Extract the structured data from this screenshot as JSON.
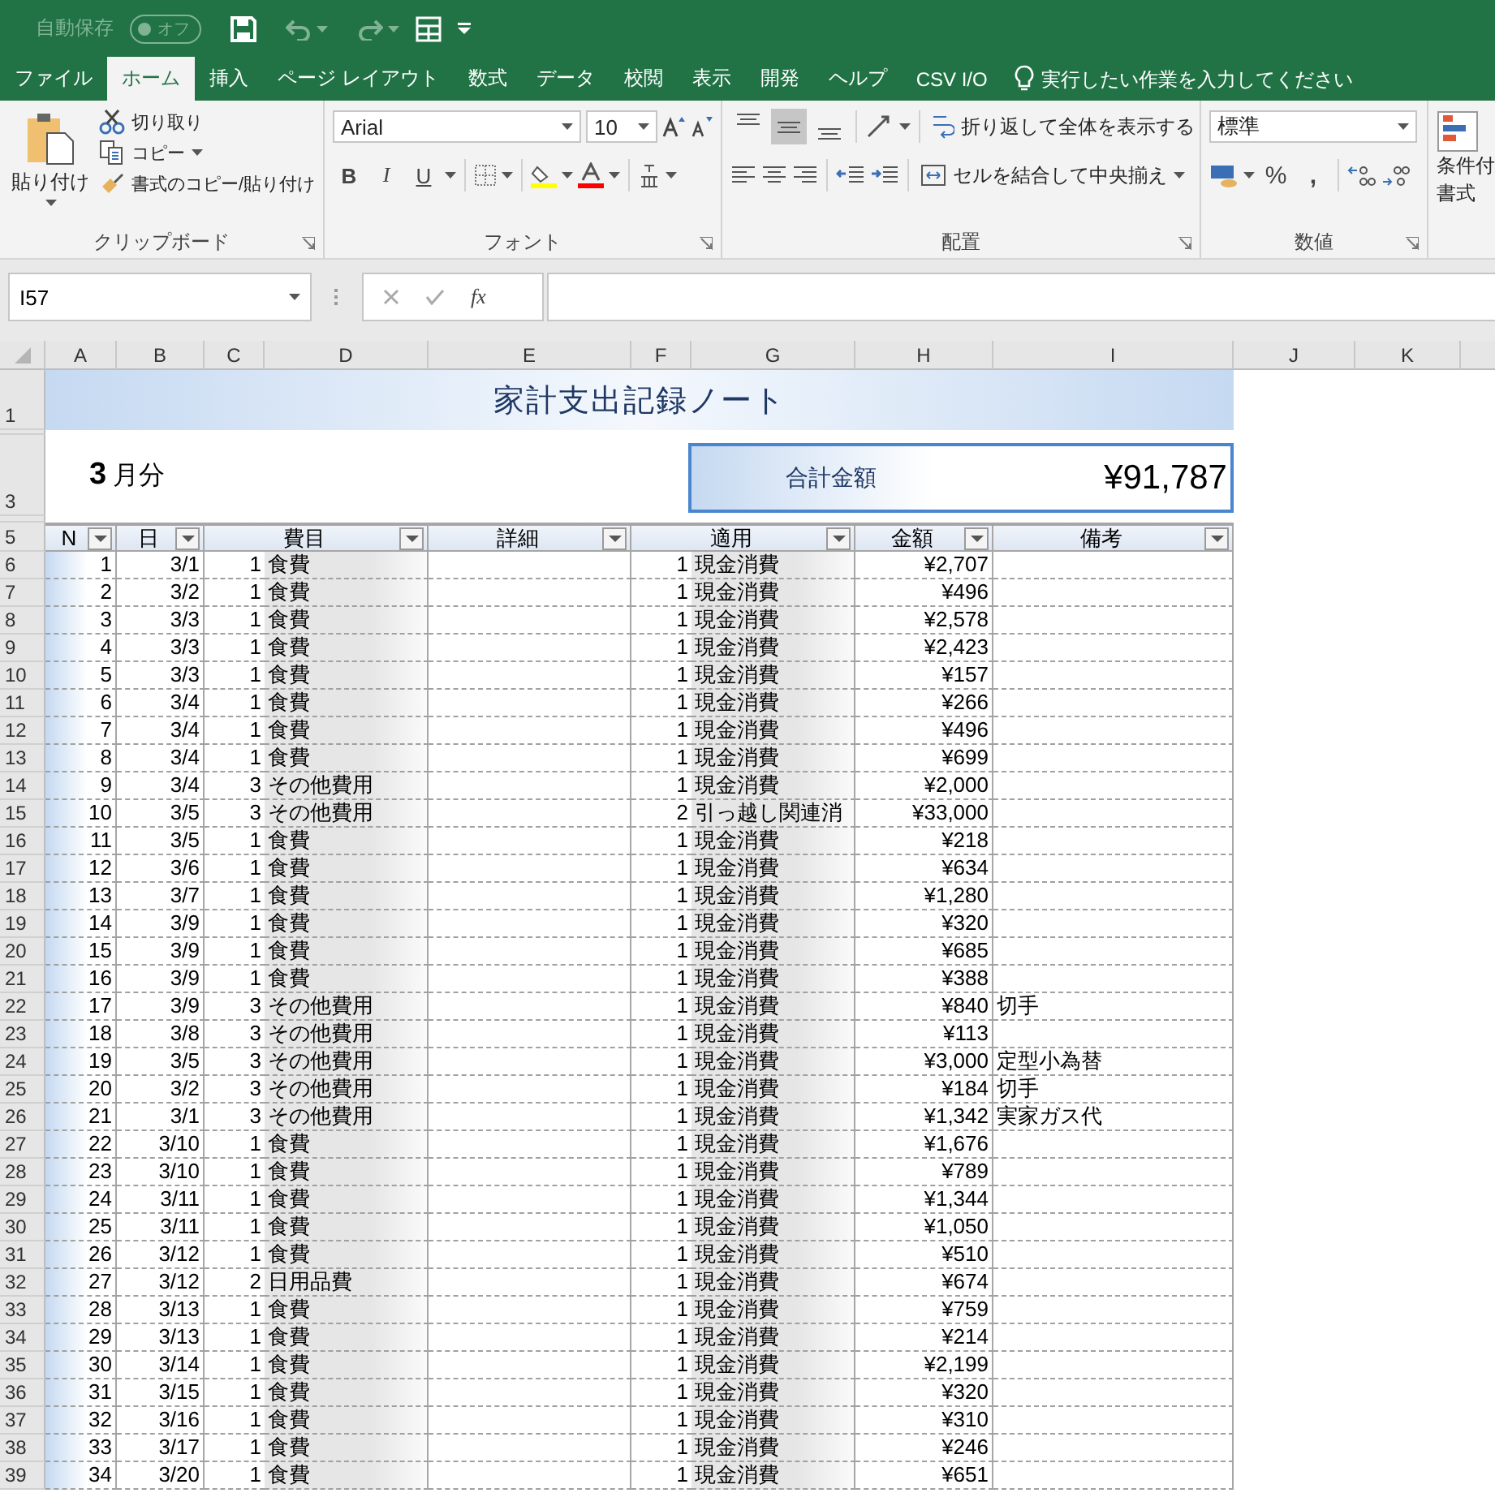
{
  "quick_access": {
    "autosave_label": "自動保存",
    "autosave_on": false,
    "autosave_state": "オフ"
  },
  "tabs": [
    {
      "label": "ファイル",
      "selected": false
    },
    {
      "label": "ホーム",
      "selected": true
    },
    {
      "label": "挿入",
      "selected": false
    },
    {
      "label": "ページ レイアウト",
      "selected": false
    },
    {
      "label": "数式",
      "selected": false
    },
    {
      "label": "データ",
      "selected": false
    },
    {
      "label": "校閲",
      "selected": false
    },
    {
      "label": "表示",
      "selected": false
    },
    {
      "label": "開発",
      "selected": false
    },
    {
      "label": "ヘルプ",
      "selected": false
    },
    {
      "label": "CSV I/O",
      "selected": false
    }
  ],
  "tell_me": {
    "placeholder": "実行したい作業を入力してください"
  },
  "ribbon": {
    "clipboard": {
      "paste": "貼り付け",
      "cut": "切り取り",
      "copy": "コピー",
      "format_painter": "書式のコピー/貼り付け",
      "label": "クリップボード"
    },
    "font": {
      "font_name": "Arial",
      "font_size": "10",
      "styles": [
        {
          "kind": "bold",
          "label": "B"
        },
        {
          "kind": "italic",
          "label": "I"
        },
        {
          "kind": "underline",
          "label": "U"
        }
      ],
      "label": "フォント"
    },
    "alignment": {
      "vertical": [
        {
          "kind": "top",
          "selected": false
        },
        {
          "kind": "middle",
          "selected": true
        },
        {
          "kind": "bottom",
          "selected": false
        }
      ],
      "wrap_text": "折り返して全体を表示する",
      "merge_center": "セルを結合して中央揃え",
      "label": "配置"
    },
    "number": {
      "format": "標準",
      "percent": "%",
      "comma": ",",
      "label": "数値"
    },
    "styles": {
      "conditional_line1": "条件付",
      "conditional_line2": "書式"
    }
  },
  "formula_bar": {
    "name_box": "I57",
    "function_button": "fx"
  },
  "sheet": {
    "columns": [
      "A",
      "B",
      "C",
      "D",
      "E",
      "F",
      "G",
      "H",
      "I",
      "J",
      "K"
    ],
    "title": "家計支出記録ノート",
    "month_number": "3",
    "month_suffix": "月分",
    "total_label": "合計金額",
    "total_value": "¥91,787",
    "header_rows": [
      "1",
      "3",
      "5"
    ],
    "headers": [
      {
        "label": "N"
      },
      {
        "label": "日"
      },
      {
        "label": "費目"
      },
      {
        "label": "詳細"
      },
      {
        "label": "適用"
      },
      {
        "label": "金額"
      },
      {
        "label": "備考"
      }
    ],
    "rows": [
      {
        "row": "6",
        "no": "1",
        "date": "3/1",
        "cat_code": "1",
        "category": "食費",
        "pay_code": "1",
        "payment": "現金消費",
        "amount": "¥2,707"
      },
      {
        "row": "7",
        "no": "2",
        "date": "3/2",
        "cat_code": "1",
        "category": "食費",
        "pay_code": "1",
        "payment": "現金消費",
        "amount": "¥496"
      },
      {
        "row": "8",
        "no": "3",
        "date": "3/3",
        "cat_code": "1",
        "category": "食費",
        "pay_code": "1",
        "payment": "現金消費",
        "amount": "¥2,578"
      },
      {
        "row": "9",
        "no": "4",
        "date": "3/3",
        "cat_code": "1",
        "category": "食費",
        "pay_code": "1",
        "payment": "現金消費",
        "amount": "¥2,423"
      },
      {
        "row": "10",
        "no": "5",
        "date": "3/3",
        "cat_code": "1",
        "category": "食費",
        "pay_code": "1",
        "payment": "現金消費",
        "amount": "¥157"
      },
      {
        "row": "11",
        "no": "6",
        "date": "3/4",
        "cat_code": "1",
        "category": "食費",
        "pay_code": "1",
        "payment": "現金消費",
        "amount": "¥266"
      },
      {
        "row": "12",
        "no": "7",
        "date": "3/4",
        "cat_code": "1",
        "category": "食費",
        "pay_code": "1",
        "payment": "現金消費",
        "amount": "¥496"
      },
      {
        "row": "13",
        "no": "8",
        "date": "3/4",
        "cat_code": "1",
        "category": "食費",
        "pay_code": "1",
        "payment": "現金消費",
        "amount": "¥699"
      },
      {
        "row": "14",
        "no": "9",
        "date": "3/4",
        "cat_code": "3",
        "category": "その他費用",
        "pay_code": "1",
        "payment": "現金消費",
        "amount": "¥2,000"
      },
      {
        "row": "15",
        "no": "10",
        "date": "3/5",
        "cat_code": "3",
        "category": "その他費用",
        "pay_code": "2",
        "payment": "引っ越し関連消",
        "amount": "¥33,000"
      },
      {
        "row": "16",
        "no": "11",
        "date": "3/5",
        "cat_code": "1",
        "category": "食費",
        "pay_code": "1",
        "payment": "現金消費",
        "amount": "¥218"
      },
      {
        "row": "17",
        "no": "12",
        "date": "3/6",
        "cat_code": "1",
        "category": "食費",
        "pay_code": "1",
        "payment": "現金消費",
        "amount": "¥634"
      },
      {
        "row": "18",
        "no": "13",
        "date": "3/7",
        "cat_code": "1",
        "category": "食費",
        "pay_code": "1",
        "payment": "現金消費",
        "amount": "¥1,280"
      },
      {
        "row": "19",
        "no": "14",
        "date": "3/9",
        "cat_code": "1",
        "category": "食費",
        "pay_code": "1",
        "payment": "現金消費",
        "amount": "¥320"
      },
      {
        "row": "20",
        "no": "15",
        "date": "3/9",
        "cat_code": "1",
        "category": "食費",
        "pay_code": "1",
        "payment": "現金消費",
        "amount": "¥685"
      },
      {
        "row": "21",
        "no": "16",
        "date": "3/9",
        "cat_code": "1",
        "category": "食費",
        "pay_code": "1",
        "payment": "現金消費",
        "amount": "¥388"
      },
      {
        "row": "22",
        "no": "17",
        "date": "3/9",
        "cat_code": "3",
        "category": "その他費用",
        "pay_code": "1",
        "payment": "現金消費",
        "amount": "¥840",
        "note": "切手"
      },
      {
        "row": "23",
        "no": "18",
        "date": "3/8",
        "cat_code": "3",
        "category": "その他費用",
        "pay_code": "1",
        "payment": "現金消費",
        "amount": "¥113"
      },
      {
        "row": "24",
        "no": "19",
        "date": "3/5",
        "cat_code": "3",
        "category": "その他費用",
        "pay_code": "1",
        "payment": "現金消費",
        "amount": "¥3,000",
        "note": "定型小為替"
      },
      {
        "row": "25",
        "no": "20",
        "date": "3/2",
        "cat_code": "3",
        "category": "その他費用",
        "pay_code": "1",
        "payment": "現金消費",
        "amount": "¥184",
        "note": "切手"
      },
      {
        "row": "26",
        "no": "21",
        "date": "3/1",
        "cat_code": "3",
        "category": "その他費用",
        "pay_code": "1",
        "payment": "現金消費",
        "amount": "¥1,342",
        "note": "実家ガス代"
      },
      {
        "row": "27",
        "no": "22",
        "date": "3/10",
        "cat_code": "1",
        "category": "食費",
        "pay_code": "1",
        "payment": "現金消費",
        "amount": "¥1,676"
      },
      {
        "row": "28",
        "no": "23",
        "date": "3/10",
        "cat_code": "1",
        "category": "食費",
        "pay_code": "1",
        "payment": "現金消費",
        "amount": "¥789"
      },
      {
        "row": "29",
        "no": "24",
        "date": "3/11",
        "cat_code": "1",
        "category": "食費",
        "pay_code": "1",
        "payment": "現金消費",
        "amount": "¥1,344"
      },
      {
        "row": "30",
        "no": "25",
        "date": "3/11",
        "cat_code": "1",
        "category": "食費",
        "pay_code": "1",
        "payment": "現金消費",
        "amount": "¥1,050"
      },
      {
        "row": "31",
        "no": "26",
        "date": "3/12",
        "cat_code": "1",
        "category": "食費",
        "pay_code": "1",
        "payment": "現金消費",
        "amount": "¥510"
      },
      {
        "row": "32",
        "no": "27",
        "date": "3/12",
        "cat_code": "2",
        "category": "日用品費",
        "pay_code": "1",
        "payment": "現金消費",
        "amount": "¥674"
      },
      {
        "row": "33",
        "no": "28",
        "date": "3/13",
        "cat_code": "1",
        "category": "食費",
        "pay_code": "1",
        "payment": "現金消費",
        "amount": "¥759"
      },
      {
        "row": "34",
        "no": "29",
        "date": "3/13",
        "cat_code": "1",
        "category": "食費",
        "pay_code": "1",
        "payment": "現金消費",
        "amount": "¥214"
      },
      {
        "row": "35",
        "no": "30",
        "date": "3/14",
        "cat_code": "1",
        "category": "食費",
        "pay_code": "1",
        "payment": "現金消費",
        "amount": "¥2,199"
      },
      {
        "row": "36",
        "no": "31",
        "date": "3/15",
        "cat_code": "1",
        "category": "食費",
        "pay_code": "1",
        "payment": "現金消費",
        "amount": "¥320"
      },
      {
        "row": "37",
        "no": "32",
        "date": "3/16",
        "cat_code": "1",
        "category": "食費",
        "pay_code": "1",
        "payment": "現金消費",
        "amount": "¥310"
      },
      {
        "row": "38",
        "no": "33",
        "date": "3/17",
        "cat_code": "1",
        "category": "食費",
        "pay_code": "1",
        "payment": "現金消費",
        "amount": "¥246"
      },
      {
        "row": "39",
        "no": "34",
        "date": "3/20",
        "cat_code": "1",
        "category": "食費",
        "pay_code": "1",
        "payment": "現金消費",
        "amount": "¥651"
      }
    ]
  }
}
